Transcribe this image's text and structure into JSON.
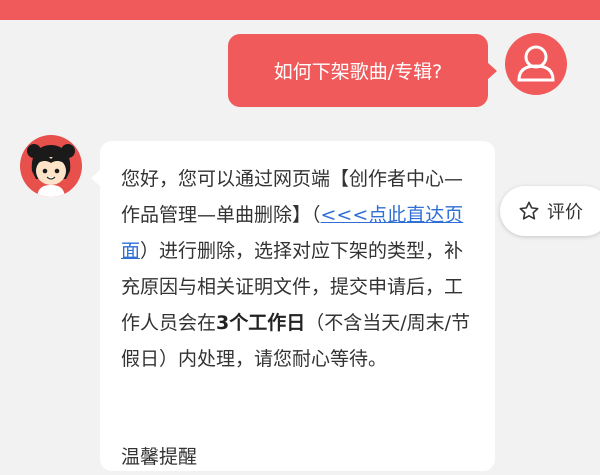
{
  "user_message": {
    "text": "如何下架歌曲/专辑?"
  },
  "bot_message": {
    "text_before_link": "您好，您可以通过网页端【创作者中心—作品管理—单曲删除】（",
    "link_text": "<<<点此直达页面",
    "text_after_link": "）进行删除，选择对应下架的类型，补充原因与相关证明文件，提交申请后，工作人员会在",
    "bold_text": "3个工作日",
    "text_end": "（不含当天/周末/节假日）内处理，请您耐心等待。",
    "footer_partial": "温馨提醒"
  },
  "rate_button": {
    "label": "评价"
  },
  "icons": {
    "user_avatar": "user-silhouette-icon",
    "bot_avatar": "cartoon-girl-avatar",
    "rate": "star-outline-icon"
  },
  "colors": {
    "accent": "#f05a5a",
    "link": "#2f6fd6",
    "background": "#f2f2f2"
  }
}
